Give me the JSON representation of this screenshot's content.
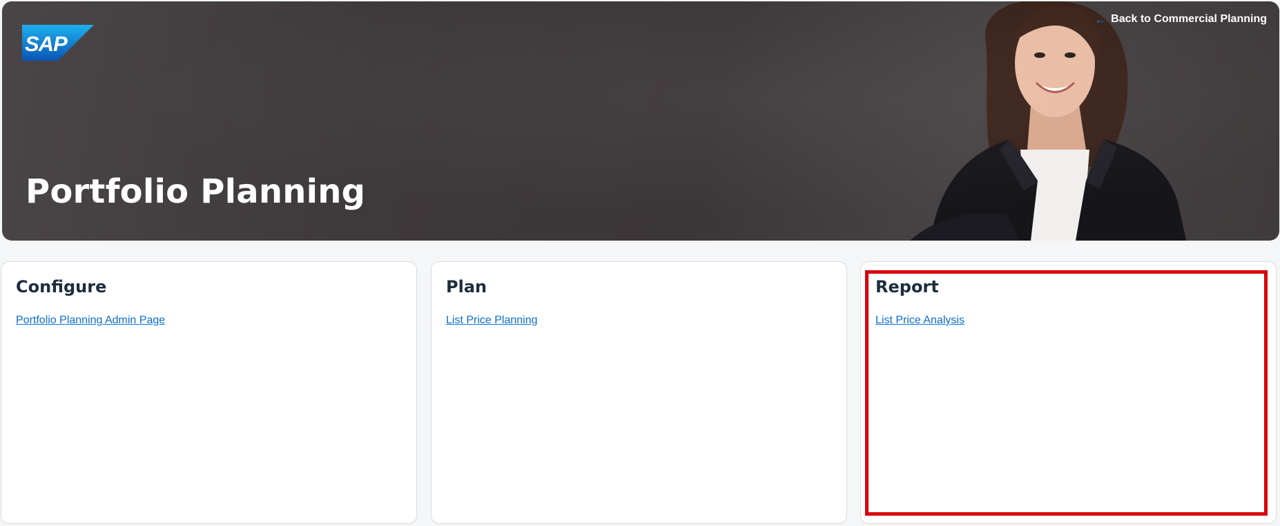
{
  "header": {
    "logo_text": "SAP",
    "title": "Portfolio Planning",
    "back_link": "Back to Commercial Planning",
    "back_icon": "arrow-left-icon"
  },
  "cards": [
    {
      "title": "Configure",
      "link": "Portfolio Planning Admin Page"
    },
    {
      "title": "Plan",
      "link": "List Price Planning"
    },
    {
      "title": "Report",
      "link": "List Price Analysis"
    }
  ],
  "colors": {
    "accent": "#0a6ed1",
    "highlight": "#d8000c",
    "hero_bg": "#3e393b"
  }
}
